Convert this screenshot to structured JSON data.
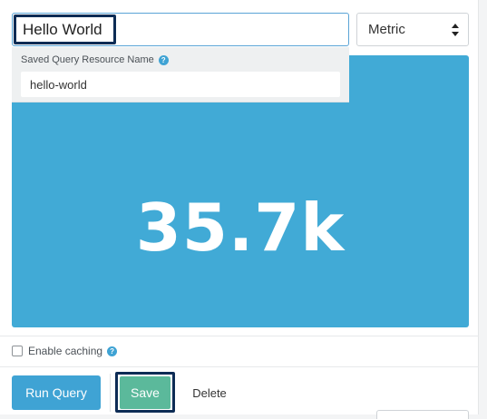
{
  "query": {
    "title_value": "Hello World",
    "visualization_type": "Metric"
  },
  "popover": {
    "label": "Saved Query Resource Name",
    "help_glyph": "?",
    "resource_name_value": "hello-world"
  },
  "metric": {
    "display_value": "35.7k",
    "tile_color": "#41aad6"
  },
  "caching": {
    "label": "Enable caching",
    "checked": false,
    "help_glyph": "?"
  },
  "actions": {
    "run_label": "Run Query",
    "save_label": "Save",
    "delete_label": "Delete"
  },
  "colors": {
    "accent_blue": "#3fa3d4",
    "save_green": "#5bb99b",
    "focus_outline": "#0d2c55"
  }
}
